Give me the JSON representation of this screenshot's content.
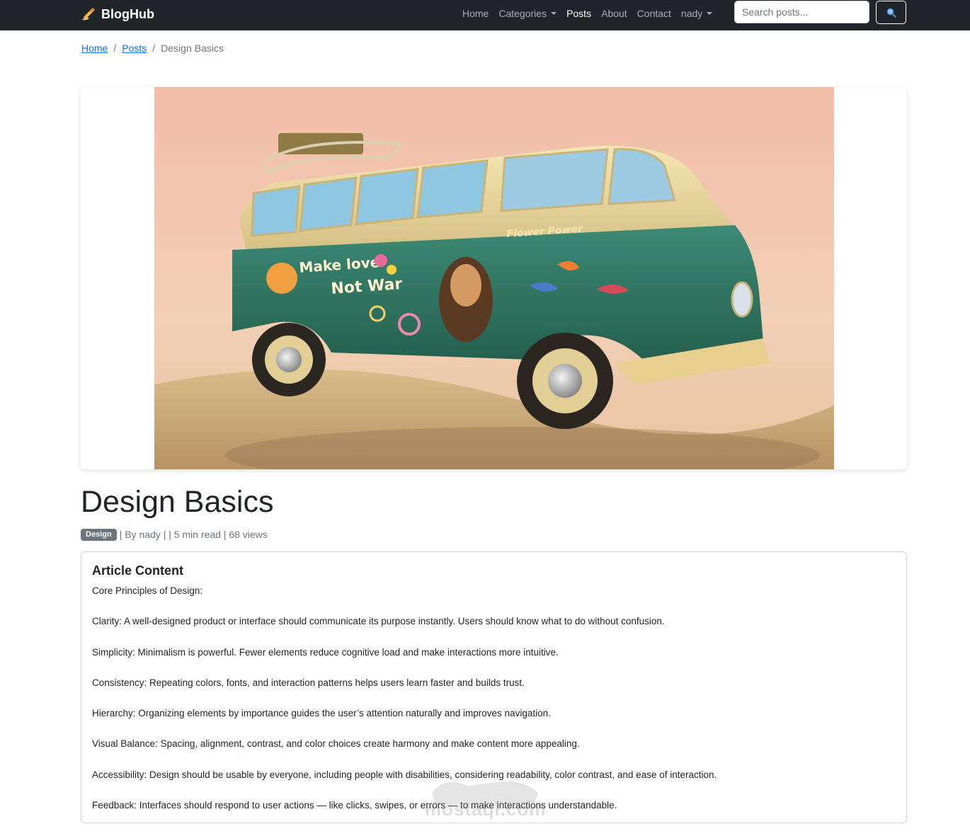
{
  "navbar": {
    "brand": "BlogHub",
    "links": [
      {
        "label": "Home",
        "dropdown": false,
        "active": false
      },
      {
        "label": "Categories",
        "dropdown": true,
        "active": false
      },
      {
        "label": "Posts",
        "dropdown": false,
        "active": true
      },
      {
        "label": "About",
        "dropdown": false,
        "active": false
      },
      {
        "label": "Contact",
        "dropdown": false,
        "active": false
      },
      {
        "label": "nady",
        "dropdown": true,
        "active": false
      }
    ],
    "search": {
      "placeholder": "Search posts...",
      "value": ""
    },
    "search_button_icon": "magnifier-icon"
  },
  "breadcrumb": {
    "items": [
      "Home",
      "Posts"
    ],
    "current": "Design Basics"
  },
  "hero": {
    "image_alt": "Vintage hippie van with Make Love Not War and Flower Power artwork on sand"
  },
  "post": {
    "title": "Design Basics",
    "category": "Design",
    "meta_text": "| By nady | | 5 min read | 68 views"
  },
  "article": {
    "heading": "Article Content",
    "paragraphs": [
      "Core Principles of Design:",
      "Clarity: A well-designed product or interface should communicate its purpose instantly. Users should know what to do without confusion.",
      "Simplicity: Minimalism is powerful. Fewer elements reduce cognitive load and make interactions more intuitive.",
      "Consistency: Repeating colors, fonts, and interaction patterns helps users learn faster and builds trust.",
      "Hierarchy: Organizing elements by importance guides the user’s attention naturally and improves navigation.",
      "Visual Balance: Spacing, alignment, contrast, and color choices create harmony and make content more appealing.",
      "Accessibility: Design should be usable by everyone, including people with disabilities, considering readability, color contrast, and ease of interaction.",
      "Feedback: Interfaces should respond to user actions — like clicks, swipes, or errors — to make interactions understandable."
    ]
  },
  "watermark": {
    "text": "mostaql.com"
  },
  "colors": {
    "navbar_bg": "#212529",
    "link": "#0d6efd",
    "badge_bg": "#6c757d",
    "van_green": "#2f7a66",
    "van_cream": "#e8d8a0"
  }
}
